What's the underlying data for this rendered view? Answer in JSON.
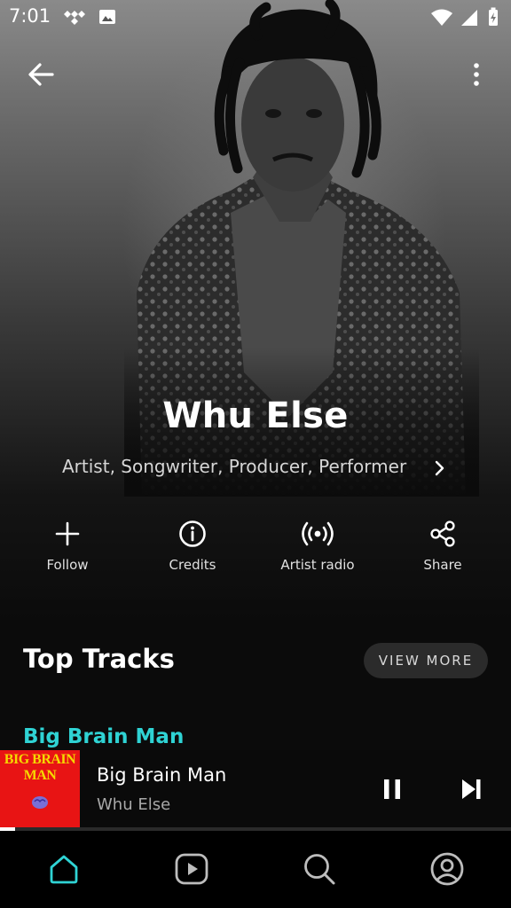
{
  "status_bar": {
    "time": "7:01",
    "left_icons": [
      "tidal-icon",
      "image-icon"
    ],
    "right_icons": [
      "wifi-icon",
      "signal-icon",
      "battery-charging-icon"
    ]
  },
  "header": {
    "back_icon": "arrow-left-icon",
    "more_icon": "more-vertical-icon"
  },
  "artist": {
    "name": "Whu Else",
    "roles": "Artist, Songwriter, Producer, Performer"
  },
  "actions": [
    {
      "label": "Follow",
      "icon": "plus-icon"
    },
    {
      "label": "Credits",
      "icon": "info-icon"
    },
    {
      "label": "Artist radio",
      "icon": "radio-icon"
    },
    {
      "label": "Share",
      "icon": "share-icon"
    }
  ],
  "top_tracks": {
    "title": "Top Tracks",
    "view_more": "VIEW MORE",
    "first_track": "Big Brain Man"
  },
  "now_playing": {
    "title": "Big Brain Man",
    "artist": "Whu Else",
    "art_text": "BIG BRAIN MAN",
    "progress_percent": 3
  },
  "bottom_nav": [
    "home-icon",
    "videos-icon",
    "search-icon",
    "profile-icon"
  ],
  "colors": {
    "accent": "#2fd3d4",
    "art_background": "#e81414",
    "art_text": "#f5d800"
  }
}
